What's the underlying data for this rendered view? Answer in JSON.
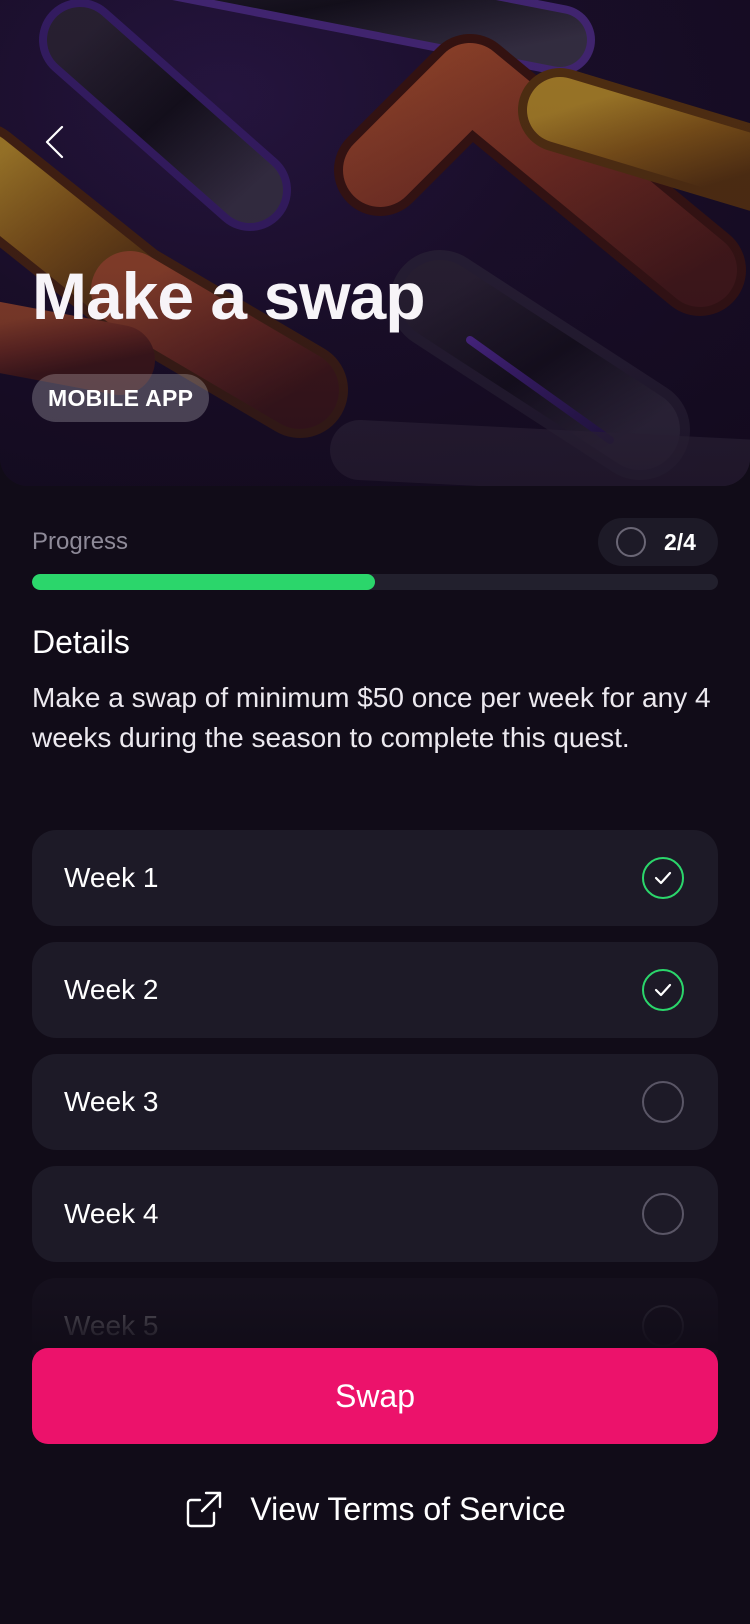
{
  "hero": {
    "title": "Make a swap",
    "tag": "MOBILE APP",
    "back_icon": "chevron-left-icon"
  },
  "progress": {
    "label": "Progress",
    "count": "2/4",
    "fraction": 0.5,
    "fill_color": "#2bd66b"
  },
  "details": {
    "heading": "Details",
    "text": "Make a swap of minimum $50 once per week for any 4 weeks during the season to complete this quest."
  },
  "weeks": [
    {
      "label": "Week 1",
      "completed": true
    },
    {
      "label": "Week 2",
      "completed": true
    },
    {
      "label": "Week 3",
      "completed": false
    },
    {
      "label": "Week 4",
      "completed": false
    },
    {
      "label": "Week 5",
      "completed": false
    }
  ],
  "actions": {
    "swap_label": "Swap",
    "tos_label": "View Terms of Service",
    "tos_icon": "external-link-icon"
  },
  "colors": {
    "background": "#110c18",
    "accent": "#ec126b",
    "success": "#2bd66b",
    "card": "#1d1a27"
  }
}
